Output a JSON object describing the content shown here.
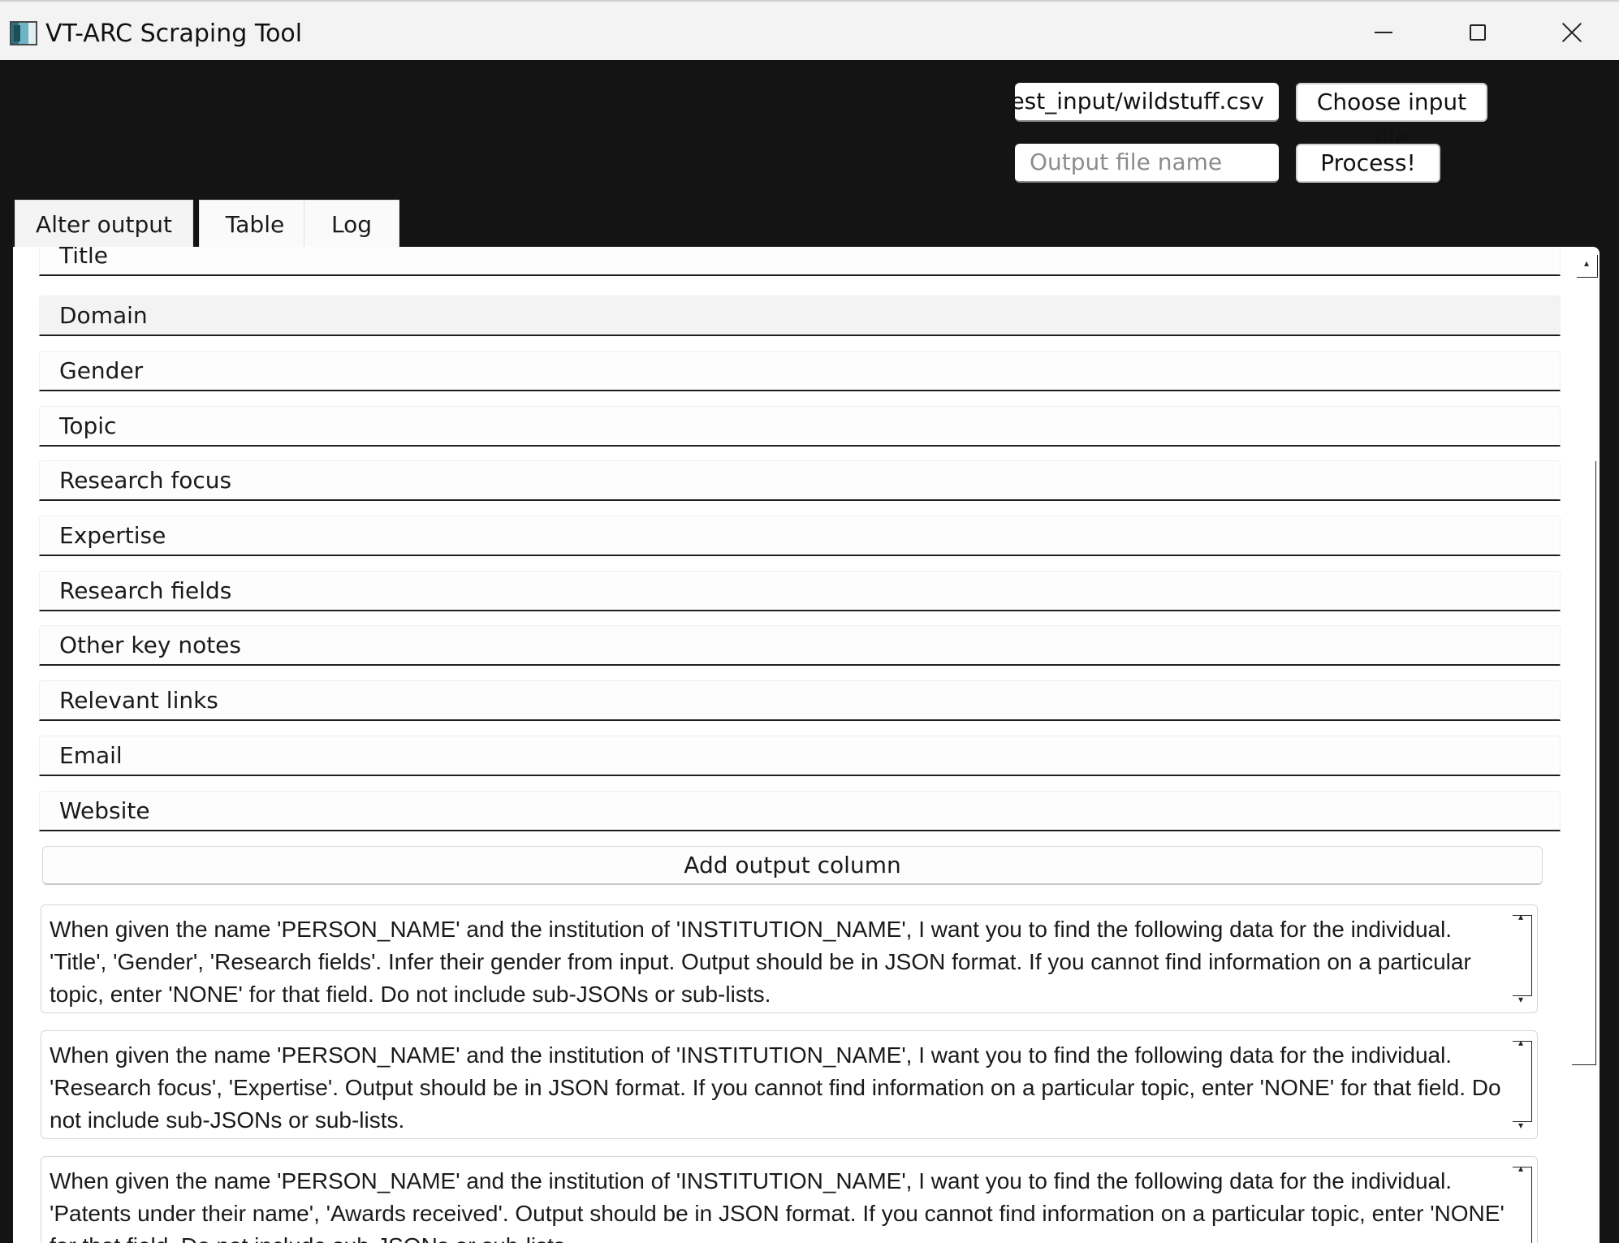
{
  "window": {
    "title": "VT-ARC Scraping Tool",
    "controls": {
      "minimize": "minimize",
      "maximize": "maximize",
      "close": "close"
    }
  },
  "controls": {
    "input_path_value": "test_input/wildstuff.csv",
    "choose_input_label": "Choose input file",
    "output_placeholder": "Output file name",
    "process_label": "Process!"
  },
  "tabs": [
    {
      "label": "Alter output",
      "selected": true
    },
    {
      "label": "Table",
      "selected": false
    },
    {
      "label": "Log",
      "selected": false
    }
  ],
  "output_columns": [
    "Title",
    "Domain",
    "Gender",
    "Topic",
    "Research focus",
    "Expertise",
    "Research fields",
    "Other key notes",
    "Relevant links",
    "Email",
    "Website"
  ],
  "add_column_label": "Add output column",
  "prompts": [
    "When given the name 'PERSON_NAME' and the institution of 'INSTITUTION_NAME', I want you to find the following data for the individual. 'Title', 'Gender', 'Research fields'. Infer their gender from input. Output should be in JSON format. If you cannot find information on a particular topic, enter 'NONE' for that field. Do not include sub-JSONs or sub-lists.",
    "When given the name 'PERSON_NAME' and the institution of 'INSTITUTION_NAME', I want you to find the following data for the individual. 'Research focus', 'Expertise'. Output should be in JSON format. If you cannot find information on a particular topic, enter 'NONE' for that field. Do not include sub-JSONs or sub-lists.",
    "When given the name 'PERSON_NAME' and the institution of 'INSTITUTION_NAME', I want you to find the following data for the individual. 'Patents under their name', 'Awards received'. Output should be in JSON format. If you cannot find information on a particular topic, enter 'NONE' for that field. Do not include sub-JSONs or sub-lists."
  ]
}
